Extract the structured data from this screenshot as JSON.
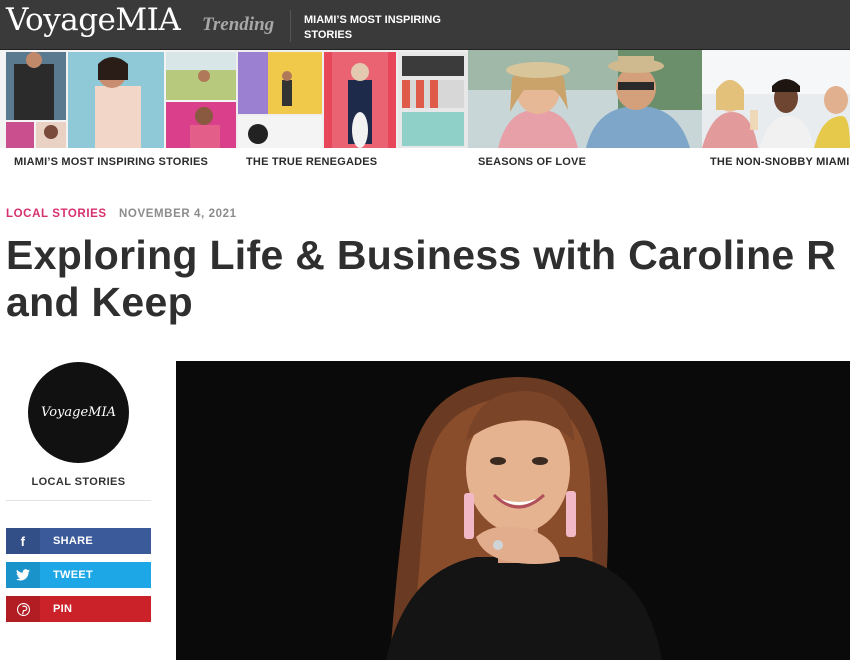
{
  "header": {
    "logo": "VoyageMIA",
    "trending_label": "Trending",
    "trending_story": "MIAMI’S MOST INSPIRING STORIES"
  },
  "strip": {
    "tiles": [
      {
        "label": "MIAMI’S MOST INSPIRING STORIES"
      },
      {
        "label": "THE TRUE RENEGADES"
      },
      {
        "label": "SEASONS OF LOVE"
      },
      {
        "label": "THE NON-SNOBBY MIAMI I"
      }
    ]
  },
  "article": {
    "category": "LOCAL STORIES",
    "date": "NOVEMBER 4, 2021",
    "title_line1": "Exploring Life & Business with Caroline R",
    "title_line2": "and Keep"
  },
  "sidebar": {
    "avatar_text": "VoyageMIA",
    "category": "LOCAL STORIES",
    "share": {
      "icon": "f",
      "label": "SHARE",
      "color": "#3b5a9a"
    },
    "tweet": {
      "icon": "twitter-bird",
      "label": "TWEET",
      "color": "#1ea7e6"
    },
    "pin": {
      "icon": "pinterest-p",
      "label": "PIN",
      "color": "#cb2128"
    }
  },
  "colors": {
    "topbar": "#3a3a3a",
    "category_accent": "#d6306e",
    "date_gray": "#8c8c8c"
  }
}
